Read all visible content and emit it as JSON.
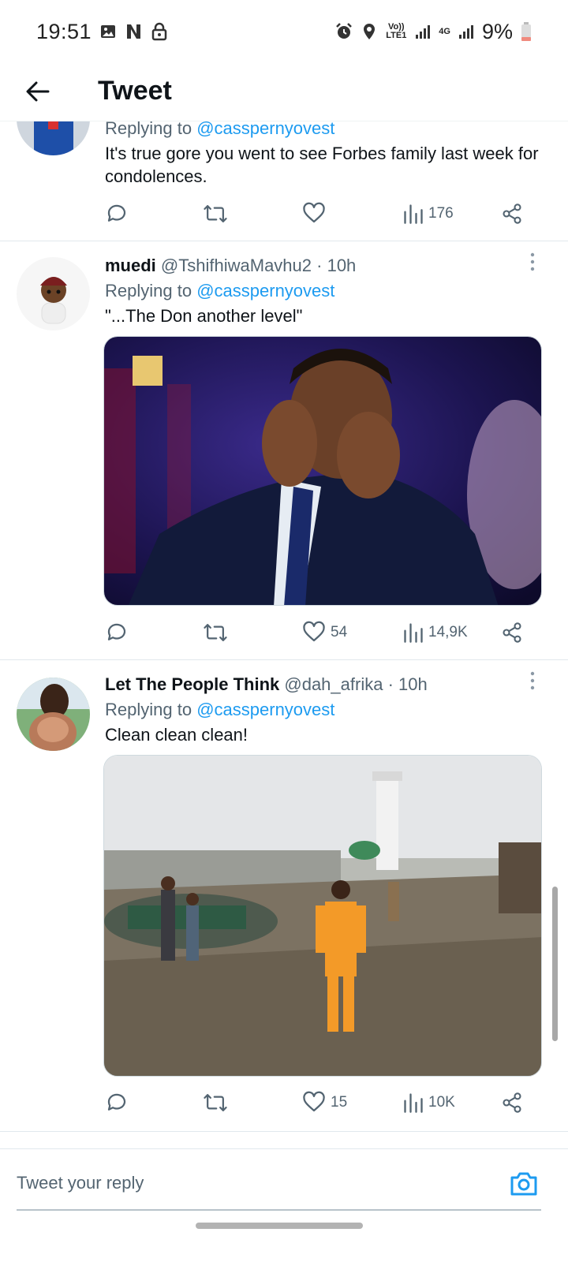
{
  "status_bar": {
    "time": "19:51",
    "left_icons": [
      "image-icon",
      "netflix-icon",
      "lock-icon"
    ],
    "right_icons": [
      "alarm-icon",
      "location-icon"
    ],
    "volte": "Vo)) LTE1",
    "network": "4G",
    "battery": "9%"
  },
  "header": {
    "title": "Tweet"
  },
  "tweets": [
    {
      "reply_prefix": "Replying to",
      "reply_to": "@casspernyovest",
      "text": "It's true gore you went to see Forbes family last week for condolences.",
      "views": "176"
    },
    {
      "name": "muedi",
      "handle": "@TshifhiwaMavhu2",
      "time": "· 10h",
      "reply_prefix": "Replying to",
      "reply_to": "@casspernyovest",
      "text": "\"...The Don another level\"",
      "likes": "54",
      "views": "14,9K"
    },
    {
      "name": "Let The People Think",
      "handle": "@dah_afrika",
      "time": "· 10h",
      "reply_prefix": "Replying to",
      "reply_to": "@casspernyovest",
      "text": "Clean clean clean!",
      "likes": "15",
      "views": "10K"
    }
  ],
  "compose": {
    "placeholder": "Tweet your reply"
  },
  "colors": {
    "accent": "#1d9bf0",
    "secondary_text": "#536471",
    "divider": "#e1e8ed"
  }
}
